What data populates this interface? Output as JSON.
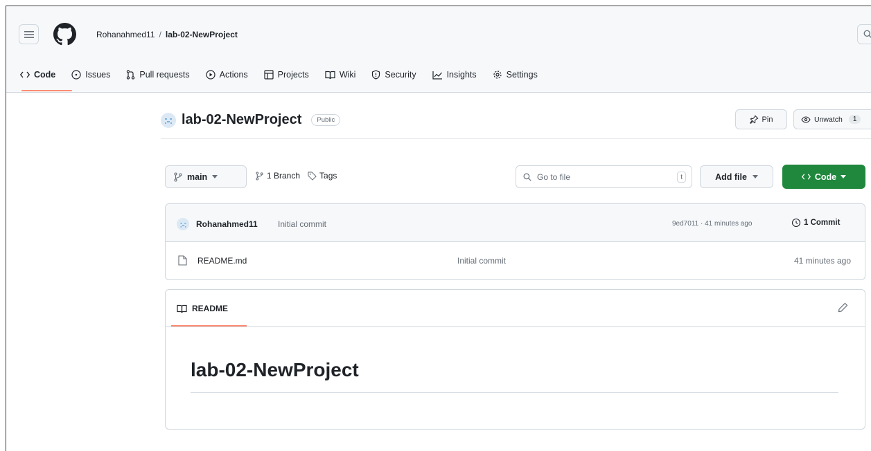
{
  "header": {
    "owner": "Rohanahmed11",
    "separator": "/",
    "repo": "lab-02-NewProject"
  },
  "nav": {
    "items": [
      {
        "label": "Code",
        "icon": "code-icon",
        "active": true
      },
      {
        "label": "Issues",
        "icon": "issue-icon"
      },
      {
        "label": "Pull requests",
        "icon": "pull-request-icon"
      },
      {
        "label": "Actions",
        "icon": "play-icon"
      },
      {
        "label": "Projects",
        "icon": "table-icon"
      },
      {
        "label": "Wiki",
        "icon": "book-icon"
      },
      {
        "label": "Security",
        "icon": "shield-icon"
      },
      {
        "label": "Insights",
        "icon": "graph-icon"
      },
      {
        "label": "Settings",
        "icon": "gear-icon"
      }
    ]
  },
  "repo": {
    "name": "lab-02-NewProject",
    "visibility": "Public",
    "pin_label": "Pin",
    "watch_label": "Unwatch",
    "watch_count": "1"
  },
  "toolbar": {
    "branch": "main",
    "branch_count": "1 Branch",
    "tags_label": "Tags",
    "goto_placeholder": "Go to file",
    "goto_shortcut": "t",
    "add_file_label": "Add file",
    "code_label": "Code"
  },
  "latest_commit": {
    "author": "Rohanahmed11",
    "message": "Initial commit",
    "meta": "9ed7011 · 41 minutes ago",
    "count_label": "1 Commit"
  },
  "files": [
    {
      "name": "README.md",
      "message": "Initial commit",
      "time": "41 minutes ago"
    }
  ],
  "readme": {
    "tab_label": "README",
    "heading": "lab-02-NewProject"
  },
  "colors": {
    "accent_underline": "#fd8c73",
    "primary_button": "#1f883d",
    "border": "#d0d7de",
    "muted_text": "#656d76"
  }
}
